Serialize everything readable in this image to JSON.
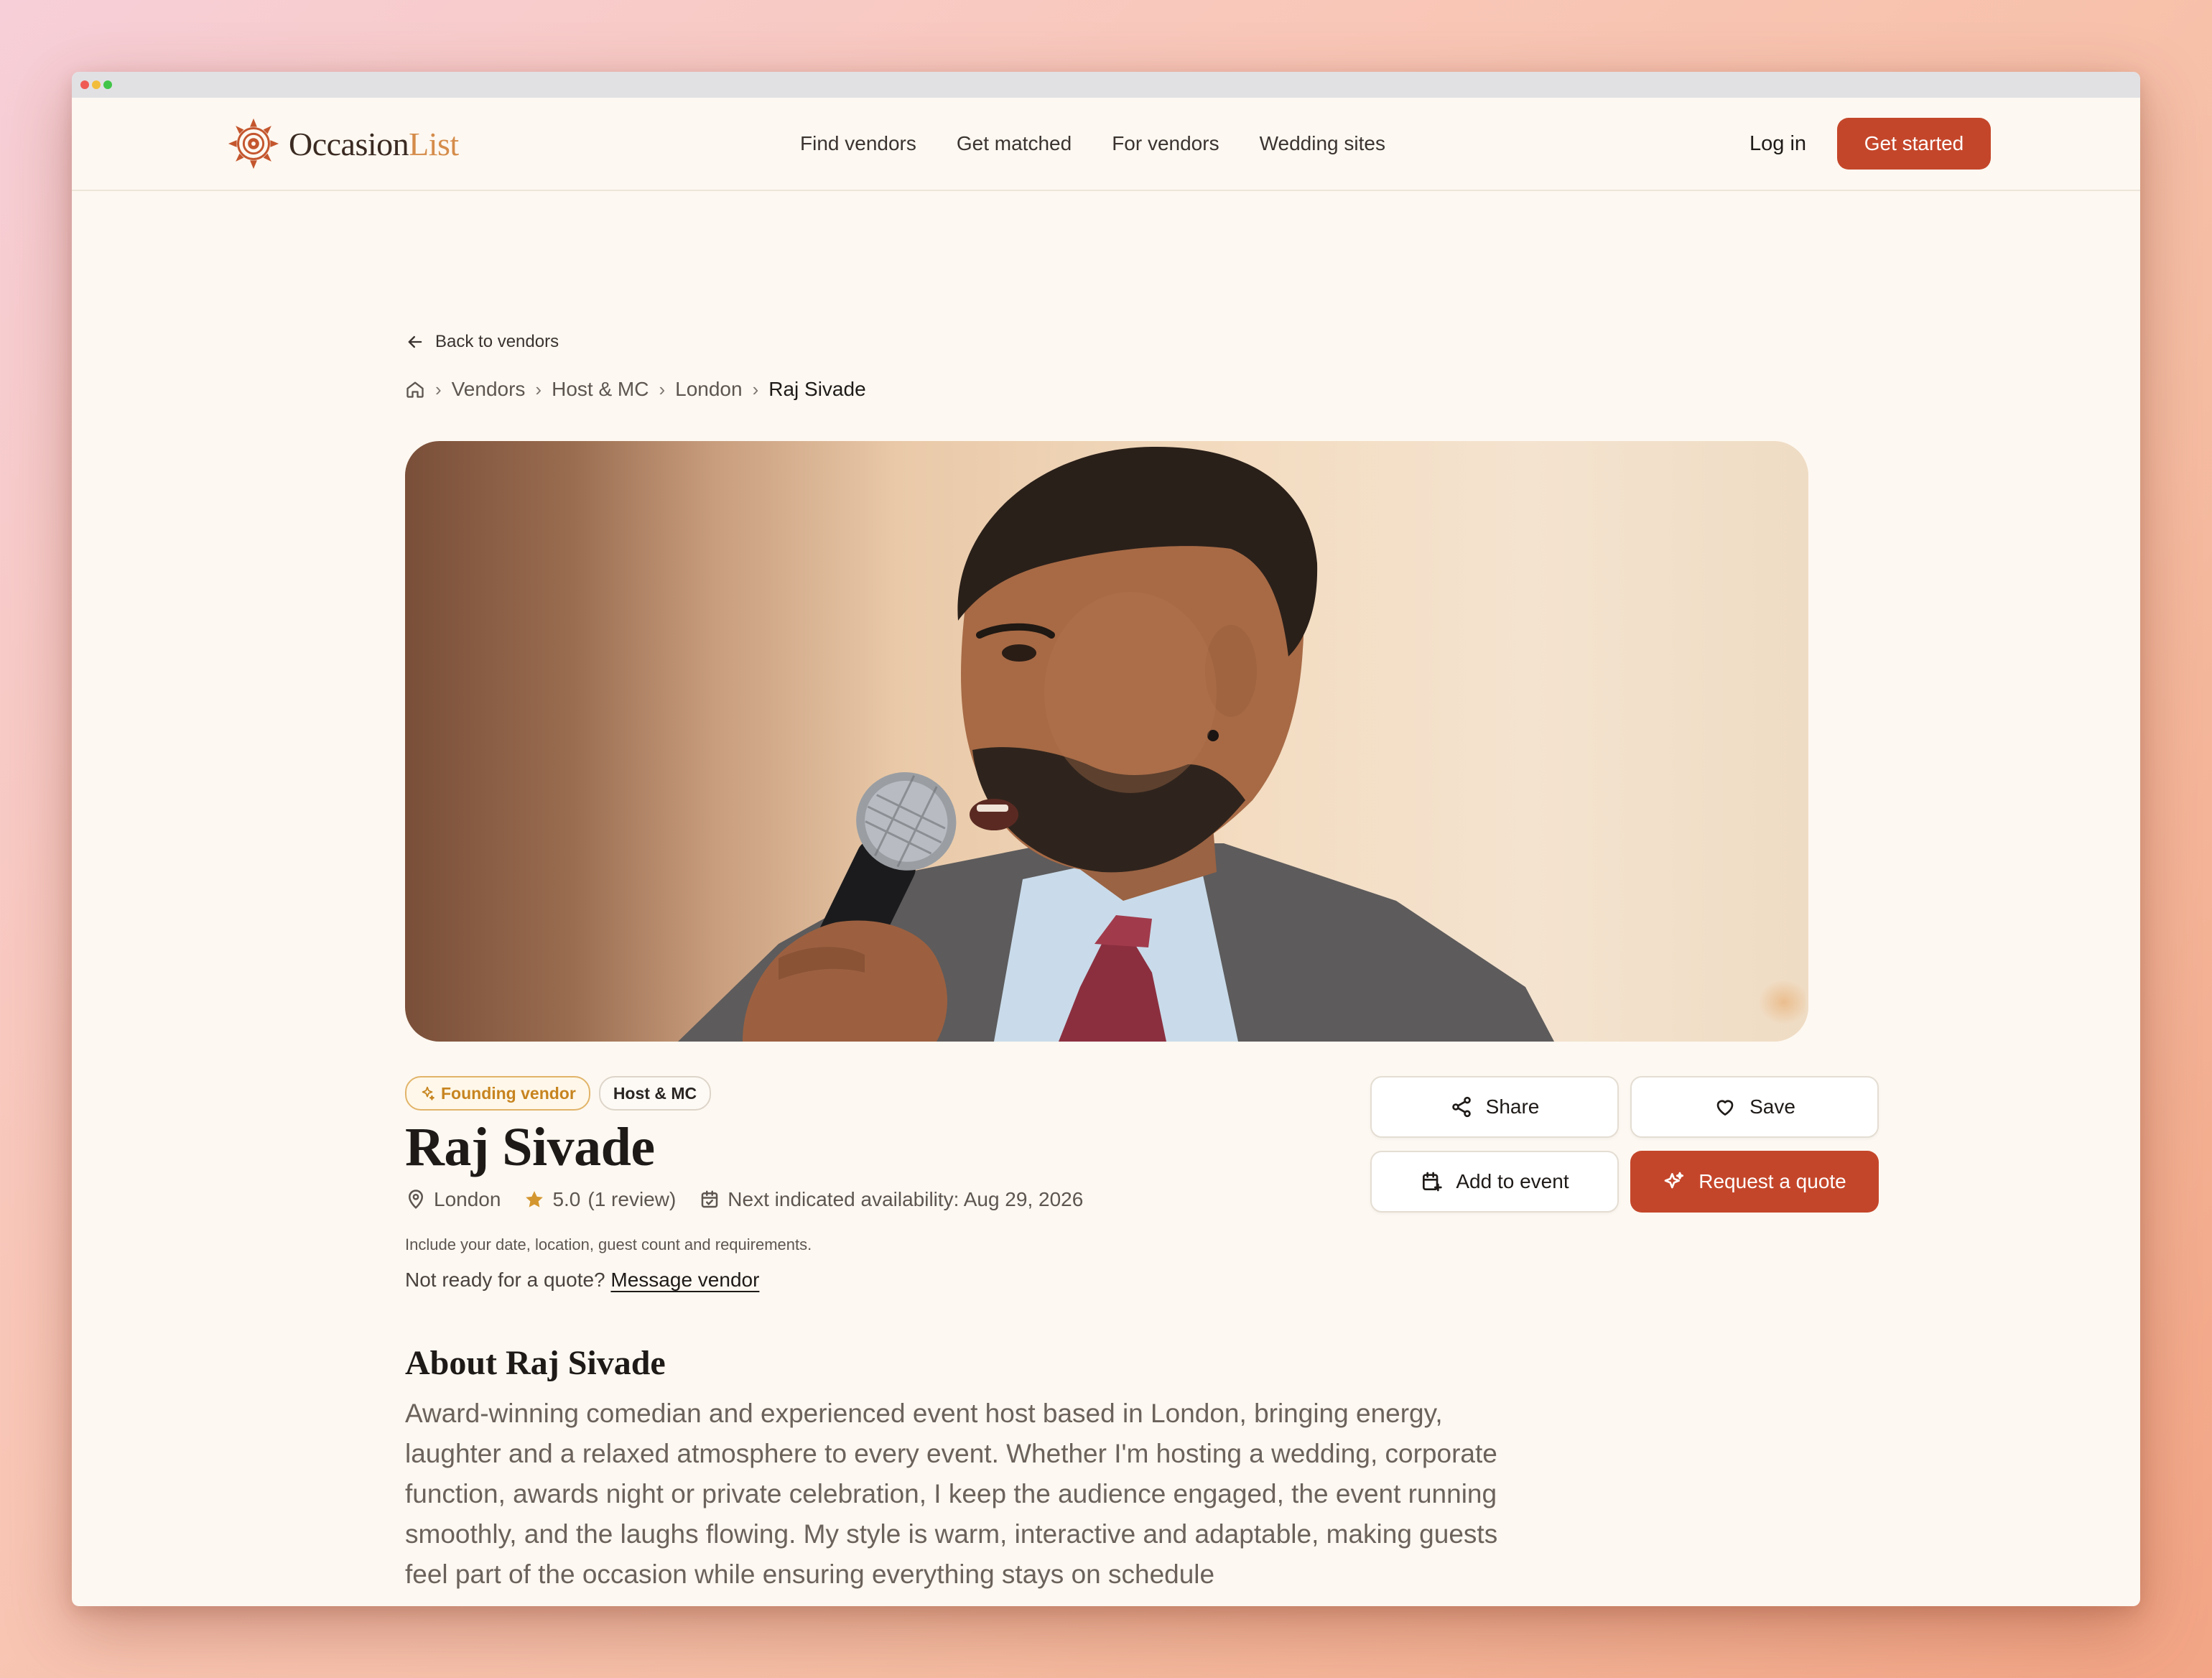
{
  "brand": {
    "name_part1": "Occasion",
    "name_part2": "List",
    "accent_color": "#d58c4a",
    "primary_color": "#c4462a"
  },
  "nav": {
    "items": [
      "Find vendors",
      "Get matched",
      "For vendors",
      "Wedding sites"
    ],
    "login": "Log in",
    "cta": "Get started"
  },
  "back": {
    "label": "Back to vendors",
    "icon": "arrow-left-icon"
  },
  "breadcrumb": {
    "items": [
      "Vendors",
      "Host & MC",
      "London"
    ],
    "current": "Raj Sivade",
    "home_icon": "home-icon"
  },
  "hero": {
    "image_alt": "Man speaking into a microphone"
  },
  "badges": {
    "founding": "Founding vendor",
    "category": "Host & MC"
  },
  "vendor": {
    "name": "Raj Sivade",
    "location": "London",
    "rating": "5.0",
    "reviews": "(1 review)",
    "availability": "Next indicated availability: Aug 29, 2026"
  },
  "hint": "Include your date, location, guest count and requirements.",
  "not_ready": {
    "text": "Not ready for a quote?",
    "link": "Message vendor"
  },
  "actions": {
    "share": "Share",
    "save": "Save",
    "add_to_event": "Add to event",
    "request_quote": "Request a quote"
  },
  "about": {
    "title": "About Raj Sivade",
    "text": "Award-winning comedian and experienced event host based in London, bringing energy, laughter and a relaxed atmosphere to every event. Whether I'm hosting a wedding, corporate function, awards night or private celebration, I keep the audience engaged, the event running smoothly, and the laughs flowing. My style is warm, interactive and adaptable, making guests feel part of the occasion while ensuring everything stays on schedule"
  }
}
